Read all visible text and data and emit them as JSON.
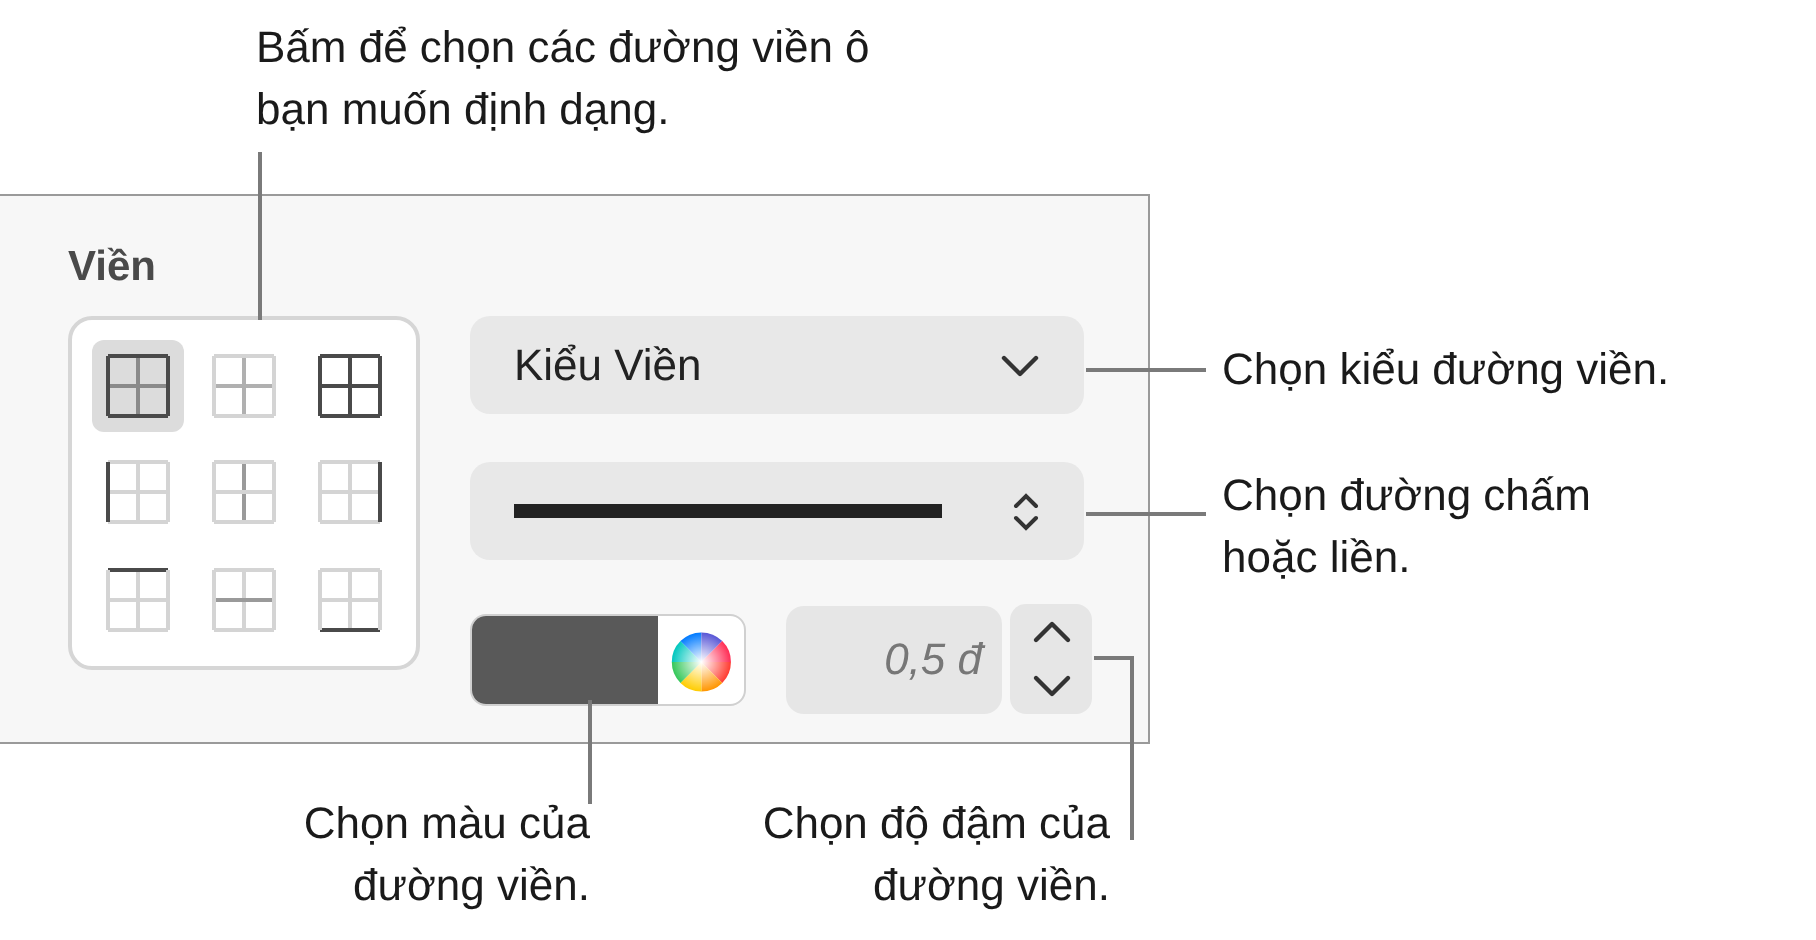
{
  "callouts": [
    {
      "kind": "top",
      "text": "Bấm để chọn các đường viền ô bạn muốn định dạng."
    },
    {
      "kind": "style",
      "text": "Chọn kiểu đường viền."
    },
    {
      "kind": "line",
      "text": "Chọn đường chấm hoặc liền."
    },
    {
      "kind": "color",
      "text": "Chọn màu của đường viền."
    },
    {
      "kind": "width",
      "text": "Chọn độ đậm của đường viền."
    }
  ],
  "panel": {
    "title": "Viền",
    "border_buttons": [
      {
        "kind": "outer",
        "selected": true
      },
      {
        "kind": "inner",
        "selected": false
      },
      {
        "kind": "all",
        "selected": false
      },
      {
        "kind": "left",
        "selected": false
      },
      {
        "kind": "vertical",
        "selected": false
      },
      {
        "kind": "right",
        "selected": false
      },
      {
        "kind": "top",
        "selected": false
      },
      {
        "kind": "horizontal",
        "selected": false
      },
      {
        "kind": "bottom",
        "selected": false
      }
    ],
    "style_menu": {
      "label": "Kiểu Viền"
    },
    "line_menu": {
      "kind": "solid"
    },
    "color_well": {
      "color": "#595959"
    },
    "width_field": {
      "value": "0,5 đ"
    }
  }
}
